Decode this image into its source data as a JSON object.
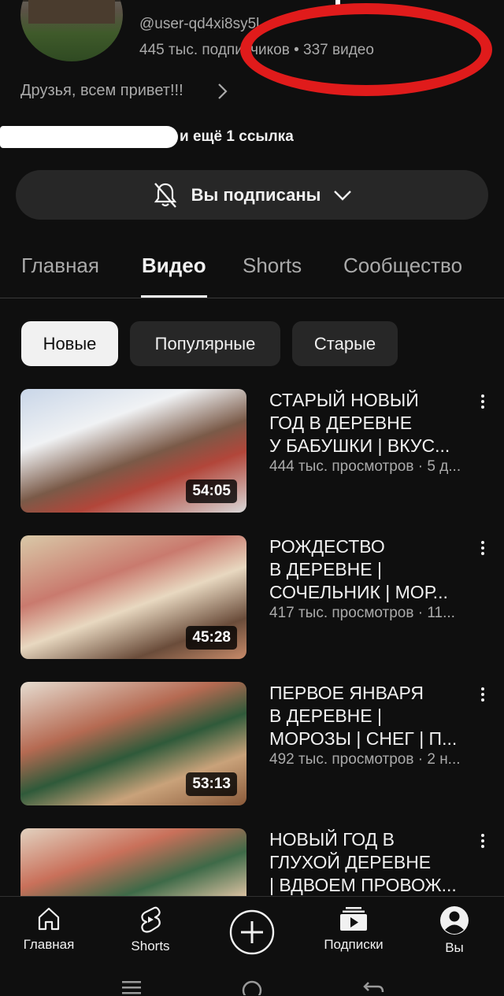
{
  "channel": {
    "handle": "@user-qd4xi8sy5l",
    "stats": "445 тыс. подписчиков • 337 видео",
    "description": "Друзья, всем привет!!!",
    "more_links": "и ещё 1 ссылка",
    "subscribe_label": "Вы подписаны"
  },
  "tabs": [
    "Главная",
    "Видео",
    "Shorts",
    "Сообщество"
  ],
  "chips": [
    "Новые",
    "Популярные",
    "Старые"
  ],
  "videos": [
    {
      "title": "СТАРЫЙ НОВЫЙ\nГОД В ДЕРЕВНЕ\nУ БАБУШКИ | ВКУС...",
      "meta": "444 тыс. просмотров · 5 д...",
      "duration": "54:05"
    },
    {
      "title": "РОЖДЕСТВО\nВ ДЕРЕВНЕ |\nСОЧЕЛЬНИК | МОР...",
      "meta": "417 тыс. просмотров · 11...",
      "duration": "45:28"
    },
    {
      "title": "ПЕРВОЕ ЯНВАРЯ\nВ ДЕРЕВНЕ |\nМОРОЗЫ | СНЕГ | П...",
      "meta": "492 тыс. просмотров · 2 н...",
      "duration": "53:13"
    },
    {
      "title": "НОВЫЙ ГОД В\nГЛУХОЙ ДЕРЕВНЕ\n| ВДВОЕМ ПРОВОЖ...",
      "meta": "",
      "duration": ""
    }
  ],
  "bottom_nav": [
    {
      "label": "Главная",
      "icon": "home-icon"
    },
    {
      "label": "Shorts",
      "icon": "shorts-icon"
    },
    {
      "label": "",
      "icon": "create-icon"
    },
    {
      "label": "Подписки",
      "icon": "subscriptions-icon"
    },
    {
      "label": "Вы",
      "icon": "profile-icon"
    }
  ],
  "colors": {
    "background": "#0f0f0f",
    "surface": "#272727",
    "annotation": "#e01b1b"
  }
}
